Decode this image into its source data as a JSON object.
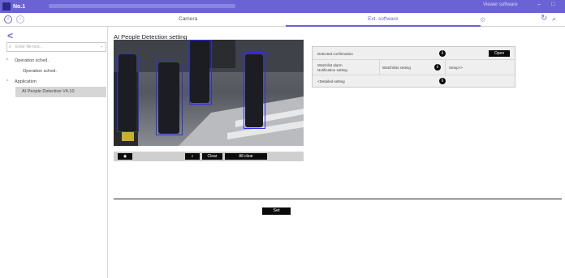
{
  "titlebar": {
    "title": "No.1",
    "viewer_label": "Viewer software",
    "minimize": "–",
    "restore": "□"
  },
  "tabs": [
    {
      "label": "Camera"
    },
    {
      "label": "Ext. software"
    }
  ],
  "sidebar": {
    "search_placeholder": "Enter file text...",
    "items": [
      {
        "label": "Operation sched."
      },
      {
        "label": "Operation sched."
      },
      {
        "label": "Application"
      },
      {
        "label": "AI People Detection V4.10"
      }
    ]
  },
  "main": {
    "title": "AI People Detection setting",
    "toolbar": {
      "clear_label": "Clear",
      "all_clear_label": "All clear"
    },
    "settings": {
      "row1_label": "Detected confirmation",
      "open_label": "Open",
      "row2_label_line1": "Watchlist alarm",
      "row2_label_line2": "Notification setting",
      "watchlist_setting": "Watchlists setting",
      "setup": "Setup>>",
      "row3_label": "<Detailed setting"
    },
    "set_label": "Set"
  },
  "colors": {
    "accent": "#6b63d4",
    "detection_box": "#2c2cf0",
    "titlebar": "#6b63d4"
  }
}
